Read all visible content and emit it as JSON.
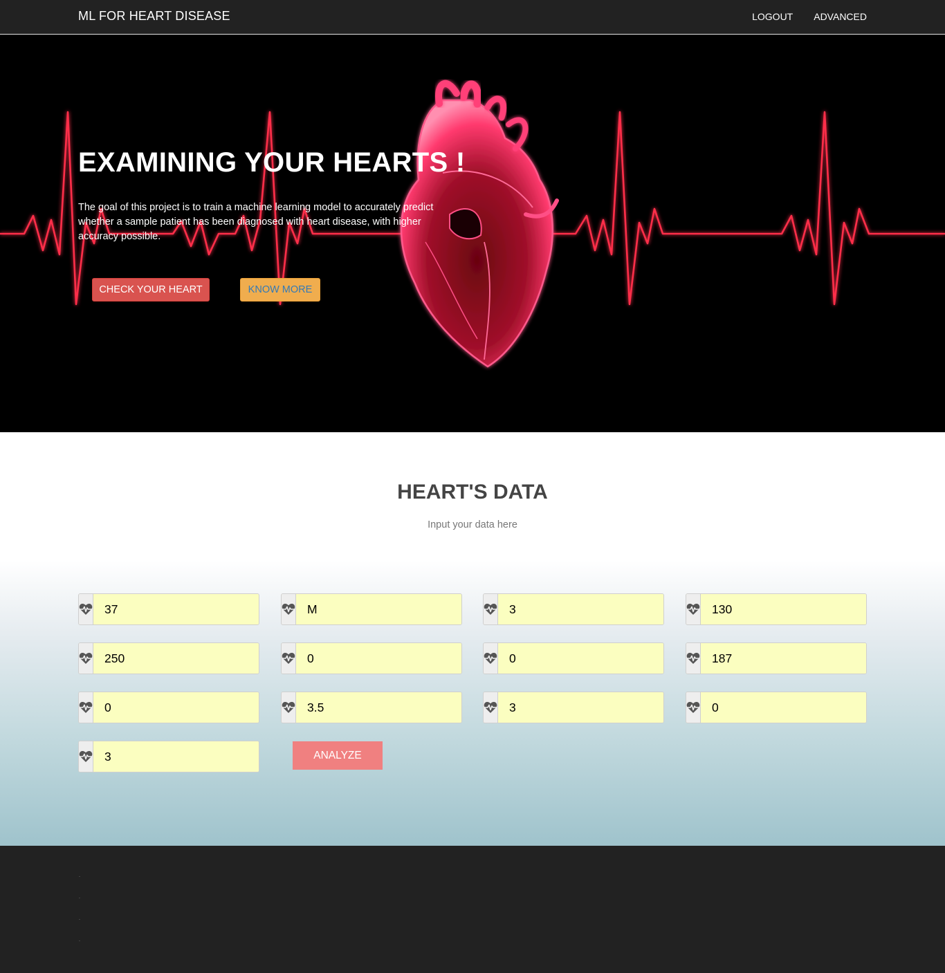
{
  "navbar": {
    "brand": "ML FOR HEART DISEASE",
    "links": [
      "LOGOUT",
      "ADVANCED"
    ]
  },
  "hero": {
    "title": "EXAMINING YOUR HEARTS !",
    "description": "The goal of this project is to train a machine learning model to accurately predict whether a sample patient has been diagnosed with heart disease, with higher accuracy possible.",
    "check_button": "CHECK YOUR HEART",
    "know_button": "KNOW MORE"
  },
  "data_section": {
    "title": "HEART'S DATA",
    "subtitle": "Input your data here",
    "fields": [
      "37",
      "M",
      "3",
      "130",
      "250",
      "0",
      "0",
      "187",
      "0",
      "3.5",
      "3",
      "0",
      "3"
    ],
    "analyze_button": "ANALYZE",
    "field_icon": "heartbeat-icon"
  },
  "footer": {
    "items": [
      ".",
      ".",
      ".",
      "."
    ]
  },
  "colors": {
    "navbar": "#222222",
    "check_button": "#d9534f",
    "know_button": "#f0ad4e",
    "analyze_button": "#f08080",
    "input_background": "#fbfec0",
    "ecg_line": "#ff2e4a"
  }
}
